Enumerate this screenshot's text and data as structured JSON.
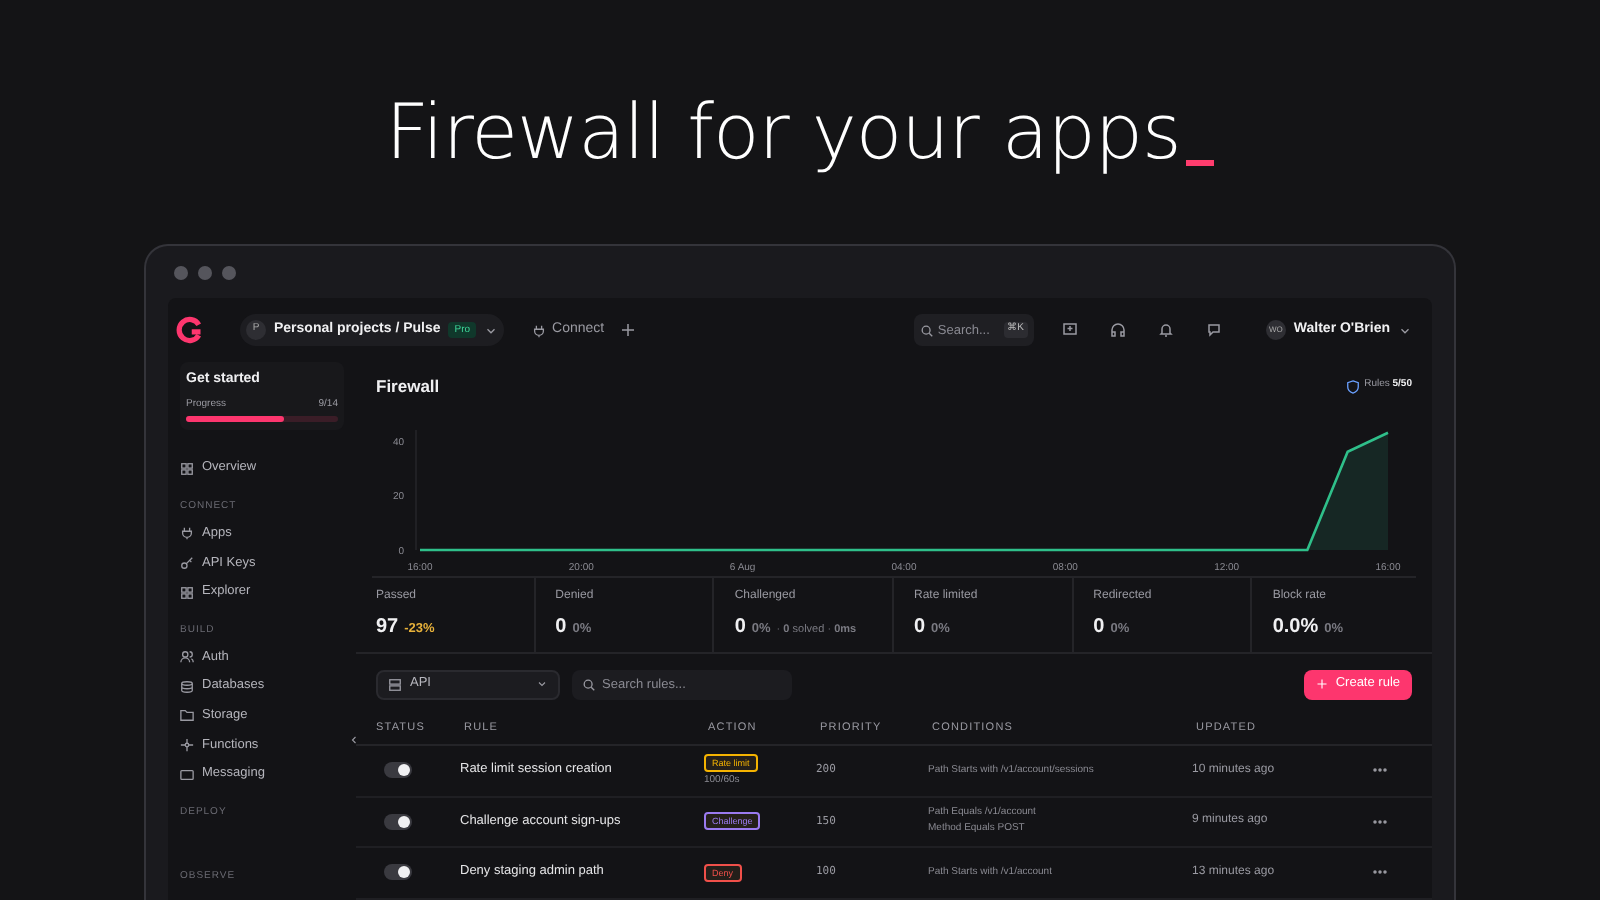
{
  "headline": "Firewall for your apps",
  "topbar": {
    "project": "Personal projects / Pulse",
    "project_initial": "P",
    "plan": "Pro",
    "connect": "Connect",
    "search_placeholder": "Search...",
    "shortcut": "⌘K",
    "user": "Walter O'Brien",
    "user_initials": "WO"
  },
  "sidebar": {
    "get_started": {
      "title": "Get started",
      "progress_label": "Progress",
      "progress_text": "9/14",
      "level": 0.64
    },
    "items": [
      {
        "kind": "item",
        "label": "Overview"
      },
      {
        "kind": "section",
        "label": "CONNECT"
      },
      {
        "kind": "item",
        "label": "Apps"
      },
      {
        "kind": "item",
        "label": "API Keys"
      },
      {
        "kind": "item",
        "label": "Explorer"
      },
      {
        "kind": "section",
        "label": "BUILD"
      },
      {
        "kind": "item",
        "label": "Auth"
      },
      {
        "kind": "item",
        "label": "Databases"
      },
      {
        "kind": "item",
        "label": "Storage"
      },
      {
        "kind": "item",
        "label": "Functions"
      },
      {
        "kind": "item",
        "label": "Messaging"
      },
      {
        "kind": "section",
        "label": "DEPLOY"
      },
      {
        "kind": "gap"
      },
      {
        "kind": "section",
        "label": "OBSERVE"
      }
    ]
  },
  "page": {
    "title": "Firewall",
    "rules_label": "Rules",
    "rules_count": "5/50"
  },
  "chart_data": {
    "type": "area",
    "categories": [
      "16:00",
      null,
      null,
      null,
      "20:00",
      null,
      null,
      null,
      "6 Aug",
      null,
      null,
      null,
      "04:00",
      null,
      null,
      null,
      "08:00",
      null,
      null,
      null,
      "12:00",
      null,
      null,
      null,
      "16:00"
    ],
    "series": [
      {
        "color": "#2fbf8a",
        "values": [
          0,
          0,
          0,
          0,
          0,
          0,
          0,
          0,
          0,
          0,
          0,
          0,
          0,
          0,
          0,
          0,
          0,
          0,
          0,
          0,
          0,
          0,
          0,
          36,
          43
        ]
      }
    ],
    "ylim": [
      0,
      44
    ],
    "yticks": [
      0,
      20,
      40
    ]
  },
  "stats": [
    {
      "label": "Passed",
      "value": "97",
      "change": "-23%",
      "color": "#e8b23a"
    },
    {
      "label": "Denied",
      "value": "0",
      "change": "0%",
      "color": "#7a7a82"
    },
    {
      "label": "Challenged",
      "value": "0",
      "change": "0%",
      "color": "#7a7a82",
      "detail": "· **0** solved · **0ms**"
    },
    {
      "label": "Rate limited",
      "value": "0",
      "change": "0%",
      "color": "#7a7a82"
    },
    {
      "label": "Redirected",
      "value": "0",
      "change": "0%",
      "color": "#7a7a82"
    },
    {
      "label": "Block rate",
      "value": "0.0%",
      "change": "0%",
      "color": "#7a7a82"
    }
  ],
  "toolbar": {
    "filter": "API",
    "search_placeholder": "Search rules...",
    "create": "Create rule"
  },
  "table": {
    "columns": [
      "STATUS",
      "RULE",
      "ACTION",
      "PRIORITY",
      "CONDITIONS",
      "UPDATED"
    ],
    "rows": [
      {
        "on": true,
        "rule": "Rate limit session creation",
        "action": {
          "label": "Rate limit",
          "color": "#f5b301",
          "detail": "100/60s"
        },
        "priority": "200",
        "conditions": [
          "Path Starts with /v1/account/sessions"
        ],
        "updated": "10 minutes ago"
      },
      {
        "on": true,
        "rule": "Challenge account sign-ups",
        "action": {
          "label": "Challenge",
          "color": "#9b7bf0"
        },
        "priority": "150",
        "conditions": [
          "Path Equals /v1/account",
          "Method Equals POST"
        ],
        "updated": "9 minutes ago"
      },
      {
        "on": true,
        "rule": "Deny staging admin path",
        "action": {
          "label": "Deny",
          "color": "#f0504a"
        },
        "priority": "100",
        "conditions": [
          "Path Starts with /v1/account"
        ],
        "updated": "13 minutes ago"
      }
    ]
  }
}
